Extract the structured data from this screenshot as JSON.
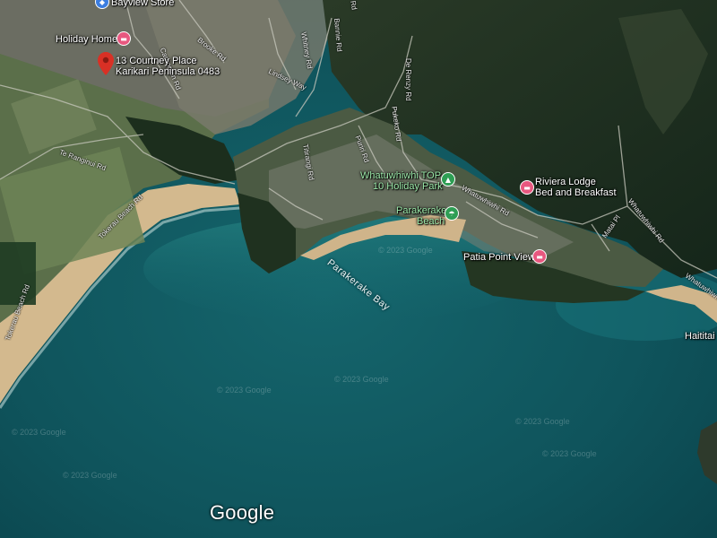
{
  "map": {
    "attribution_logo": "Google",
    "watermark_text": "© 2023 Google",
    "colors": {
      "water_deep": "#0c4e57",
      "water_shallow": "#16737a",
      "sand": "#d2b88c",
      "forest": "#1b2d1e",
      "pasture": "#5c7349",
      "suburb": "#6e6f63",
      "label": "#ffffff",
      "pin_pink": "#e8577f",
      "pin_green": "#2e9e54",
      "marker_red": "#d93025"
    }
  },
  "selected_location": {
    "line1": "13 Courtney Place",
    "line2": "Karikari Peninsula 0483",
    "icon": "map-marker-icon"
  },
  "places": {
    "bayview_store": "Bayview Store",
    "holiday_home": "Holiday Home",
    "whatuwhiwhi_line1": "Whatuwhiwhi TOP",
    "whatuwhiwhi_line2": "10 Holiday Park",
    "parakerake_beach_line1": "Parakerake",
    "parakerake_beach_line2": "Beach",
    "riviera_line1": "Riviera Lodge",
    "riviera_line2": "Bed and Breakfast",
    "patia_point": "Patia Point View",
    "haititaimarangai": "Haititai",
    "bay": "Parakerake Bay"
  },
  "roads": {
    "carrington": "Carrington Rd",
    "brooke": "Brooke Rd",
    "whitney": "Whitney Rd",
    "lindsey": "Lindsey Way",
    "bannie": "Bannie Rd",
    "te_ranginui": "Te Ranginui Rd",
    "tokerau_beach": "Tokerau Beach Rd",
    "titirangi": "Titirangi Rd",
    "whatuwhiwhi": "Whatuwhiwhi Rd",
    "whatuwhiwhi_2": "Whatuwhiwhi Rd",
    "whatuwhiwhi_3": "Whatuwhiwhi",
    "matai": "Matai Pl",
    "tokerau_beach_2": "Tokerau Beach Rd",
    "de_renzy": "De Renzy Rd",
    "pukeko": "Pukeko Rd",
    "puriri": "Puriri Rd",
    "top_road": "Rd"
  }
}
